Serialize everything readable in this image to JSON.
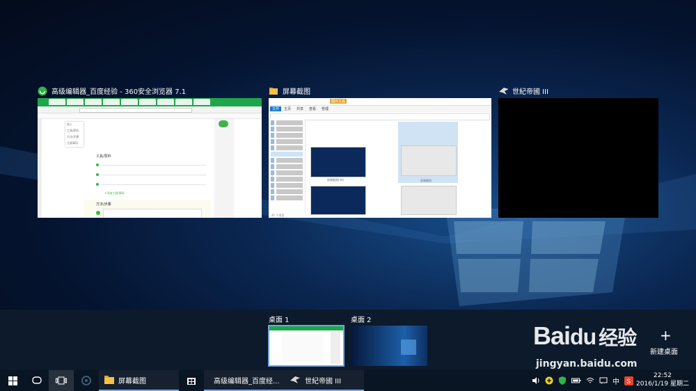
{
  "windows": [
    {
      "title": "高级编辑器_百度经验 - 360安全浏览器 7.1",
      "icon": "360-browser-icon"
    },
    {
      "title": "屏幕截图",
      "icon": "folder-icon"
    },
    {
      "title": "世紀帝國 III",
      "icon": "age-of-empires-icon"
    }
  ],
  "desktops": {
    "items": [
      {
        "label": "桌面 1"
      },
      {
        "label": "桌面 2"
      }
    ],
    "new_label": "新建桌面",
    "new_icon": "plus-icon"
  },
  "taskbar": {
    "apps": [
      {
        "label": "屏幕截图",
        "icon": "folder-icon"
      },
      {
        "label": "",
        "icon": "store-icon"
      },
      {
        "label": "高级编辑器_百度经...",
        "icon": "360-browser-icon"
      },
      {
        "label": "世紀帝國 III",
        "icon": "age-of-empires-icon"
      }
    ],
    "ime": "中",
    "time": "22:52",
    "date": "2016/1/19 星期二"
  },
  "browser_thumb": {
    "section1": "工具/原料",
    "section2": "方法/步骤",
    "add_tool": "+添加工具/原料",
    "menu": [
      "插入",
      "工具/原料",
      "方法/步骤",
      "注意事项"
    ]
  },
  "explorer_thumb": {
    "tabs": [
      "文件",
      "主页",
      "共享",
      "查看",
      "管理"
    ],
    "ribbon_tag": "图片工具",
    "nav": [
      "快速访问",
      "下载",
      "桌面",
      "图片",
      "360Chrome",
      "屏幕截图",
      "本地磁盘 (H:)",
      "KuaiwanGames",
      "本地磁盘 (G:)",
      "电子书",
      "OneDrive",
      "此电脑",
      "网络"
    ],
    "files": [
      "屏幕截图(36)",
      "屏幕截图"
    ],
    "status": "41 个项目"
  },
  "watermark": {
    "brand": "Bai",
    "paw": "du",
    "jingyan": "经验",
    "url": "jingyan.baidu.com"
  },
  "colors": {
    "accent": "#79a9e6",
    "green": "#1ea64b",
    "taskbar": "#0a1523"
  }
}
